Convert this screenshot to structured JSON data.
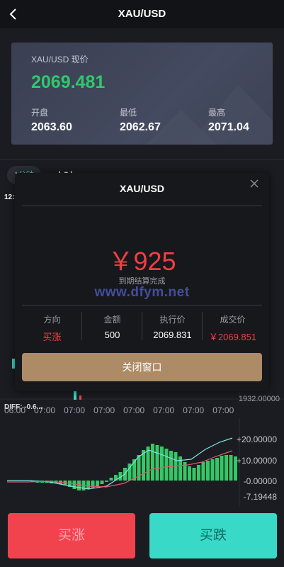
{
  "header": {
    "title": "XAU/USD",
    "back_icon": "chevron-left-icon"
  },
  "quote": {
    "label": "XAU/USD 现价",
    "price": "2069.481",
    "stats": [
      {
        "label": "开盘",
        "value": "2063.60"
      },
      {
        "label": "最低",
        "value": "2062.67"
      },
      {
        "label": "最高",
        "value": "2071.04"
      }
    ]
  },
  "tabs": {
    "active": "1分钟",
    "second": "1小时"
  },
  "chart": {
    "time_label": "12:",
    "price_ticks": [
      "1932.00000"
    ],
    "diff_label": "DIFF: -0.6...",
    "time_labels": [
      "06:00",
      "06:00",
      "07:00",
      "07:00",
      "07:00",
      "07:00",
      "07:00",
      "07:00",
      "07:00"
    ],
    "macd_ticks": [
      "+20.00000",
      "+10.00000",
      "-0.00000",
      "-7.19448"
    ]
  },
  "dialog": {
    "title": "XAU/USD",
    "amount": "￥925",
    "status": "到期结算完成",
    "watermark": "www.dfym.net",
    "columns": [
      {
        "header": "方向",
        "value": "买涨",
        "color": "#ef3f42"
      },
      {
        "header": "金额",
        "value": "500",
        "color": "#ffffff"
      },
      {
        "header": "执行价",
        "value": "2069.831",
        "color": "#ffffff"
      },
      {
        "header": "成交价",
        "value": "￥2069.851",
        "color": "#ef3f42"
      }
    ],
    "close_button": "关闭窗口"
  },
  "actions": {
    "buy_up": "买涨",
    "buy_down": "买跌"
  },
  "colors": {
    "up": "#f0434e",
    "down": "#39d9c7",
    "price_green": "#2fc86e",
    "accent_gold": "#ad8b66"
  }
}
